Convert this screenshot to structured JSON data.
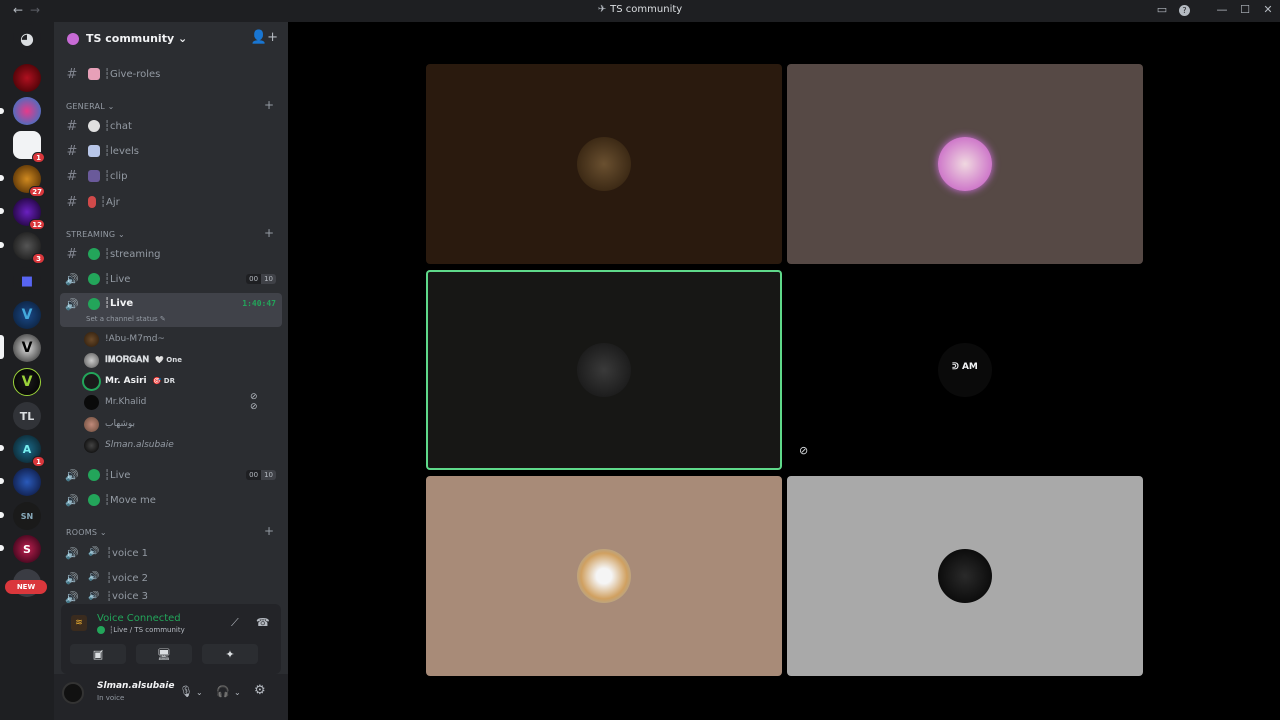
{
  "window": {
    "title": "TS community",
    "back_icon": "←",
    "forward_icon": "→",
    "controls": {
      "inbox": "▭",
      "help": "?",
      "minimize": "—",
      "maximize": "☐",
      "close": "✕"
    }
  },
  "rail": {
    "home_icon": "◕",
    "tl_label": "TL",
    "new_label": "NEW",
    "badges": [
      "1",
      "27",
      "12",
      "3",
      "1"
    ]
  },
  "guild": {
    "name": "TS community ⌄",
    "invite_icon": "👤+"
  },
  "channels": {
    "give_roles": "┆Give-roles",
    "general_label": "GENERAL ⌄",
    "chat": "┆chat",
    "levels": "┆levels",
    "clip": "┆clip",
    "ajr": "┆Ajr",
    "streaming_label": "STREAMING ⌄",
    "streaming": "┆streaming",
    "live1": "┆Live",
    "live1_count": [
      "00",
      "10"
    ],
    "live_active": "┆Live",
    "live_timer": "1:40:47",
    "status_note": "Set a channel status ✎",
    "live3": "┆Live",
    "live3_count": [
      "00",
      "10"
    ],
    "move_me": "┆Move me",
    "rooms_label": "ROOMS ⌄",
    "voice1": "┆voice 1",
    "voice2": "┆voice 2",
    "voice3": "┆voice 3",
    "add": "+"
  },
  "voice_users": [
    {
      "name": "!Abu-M7md~",
      "tag": ""
    },
    {
      "name": "𝐈𝐌𝐎𝐑𝐆𝐀𝐍",
      "tag": "🤍 One"
    },
    {
      "name": "Mr. Asiri",
      "tag": "🎯 DR"
    },
    {
      "name": "Mr.Khalid",
      "tag": ""
    },
    {
      "name": "بوشهاب",
      "tag": ""
    },
    {
      "name": "Slman.alsubaie",
      "tag": ""
    }
  ],
  "voice_panel": {
    "title": "Voice Connected",
    "subtitle": "┆Live / TS community",
    "buttons": [
      "▣̸",
      "🖥",
      "✦",
      "🎉"
    ]
  },
  "user": {
    "name": "Slman.alsubaie",
    "status": "In voice",
    "mic_icon": "🎙",
    "headset_icon": "🎧",
    "settings_icon": "⚙"
  },
  "stage": {
    "tile4_text": "ᕲ AM",
    "tile4_icon": "⊘"
  },
  "colors": {
    "accent_green": "#23a55a",
    "speaking_border": "#5fd98a",
    "badge_red": "#da373c"
  }
}
